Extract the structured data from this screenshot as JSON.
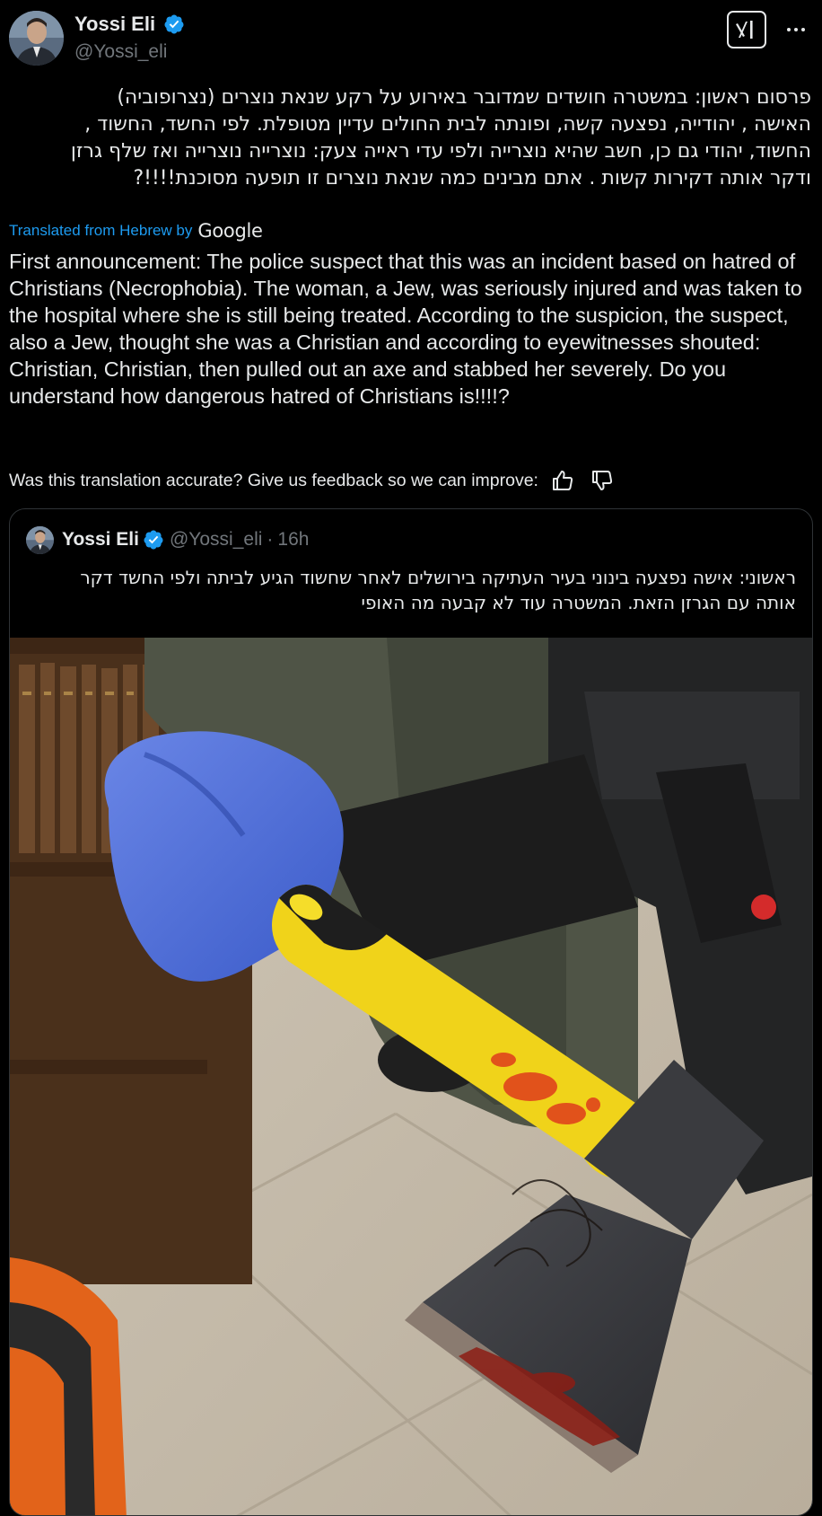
{
  "author": {
    "display_name": "Yossi Eli",
    "handle": "@Yossi_eli"
  },
  "post": {
    "hebrew_lines": [
      "פרסום ראשון: במשטרה חושדים שמדובר באירוע על רקע שנאת נוצרים (נצרופוביה)",
      "האישה , יהודייה, נפצעה קשה, ופונתה לבית החולים עדיין מטופלת. לפי החשד, החשוד ,",
      "החשוד, יהודי גם כן, חשב שהיא נוצרייה ולפי עדי ראייה צעק: נוצרייה נוצרייה ואז שלף גרזן",
      "ודקר אותה דקירות קשות . אתם מבינים כמה שנאת נוצרים זו תופעה מסוכנת!!!!?"
    ],
    "translated_from": "Translated from Hebrew by",
    "translator_brand": "Google",
    "translation": "First announcement: The police suspect that this was an incident based on hatred of Christians (Necrophobia). The woman, a Jew, was seriously injured and was taken to the hospital where she is still being treated. According to the suspicion, the suspect, also a Jew, thought she was a Christian and according to eyewitnesses shouted: Christian, Christian, then pulled out an axe and stabbed her severely. Do you understand how dangerous hatred of Christians is!!!!?",
    "feedback_prompt": "Was this translation accurate? Give us feedback so we can improve:"
  },
  "quote": {
    "display_name": "Yossi Eli",
    "handle": "@Yossi_eli",
    "separator": "·",
    "time": "16h",
    "hebrew_lines": [
      "ראשוני: אישה נפצעה בינוני בעיר העתיקה בירושלים לאחר שחשוד הגיע לביתה ולפי החשד דקר",
      "אותה עם הגרזן הזאת. המשטרה עוד לא קבעה מה האופי"
    ]
  },
  "icons": {
    "verified": "verified-badge-icon",
    "grok": "grok-icon",
    "more": "more-horizontal-icon",
    "thumbs_up": "thumbs-up-icon",
    "thumbs_down": "thumbs-down-icon"
  },
  "colors": {
    "background": "#000000",
    "text": "#e7e9ea",
    "secondary": "#71767b",
    "link": "#1d9bf0",
    "verified": "#1d9bf0",
    "border": "#2f3336"
  }
}
